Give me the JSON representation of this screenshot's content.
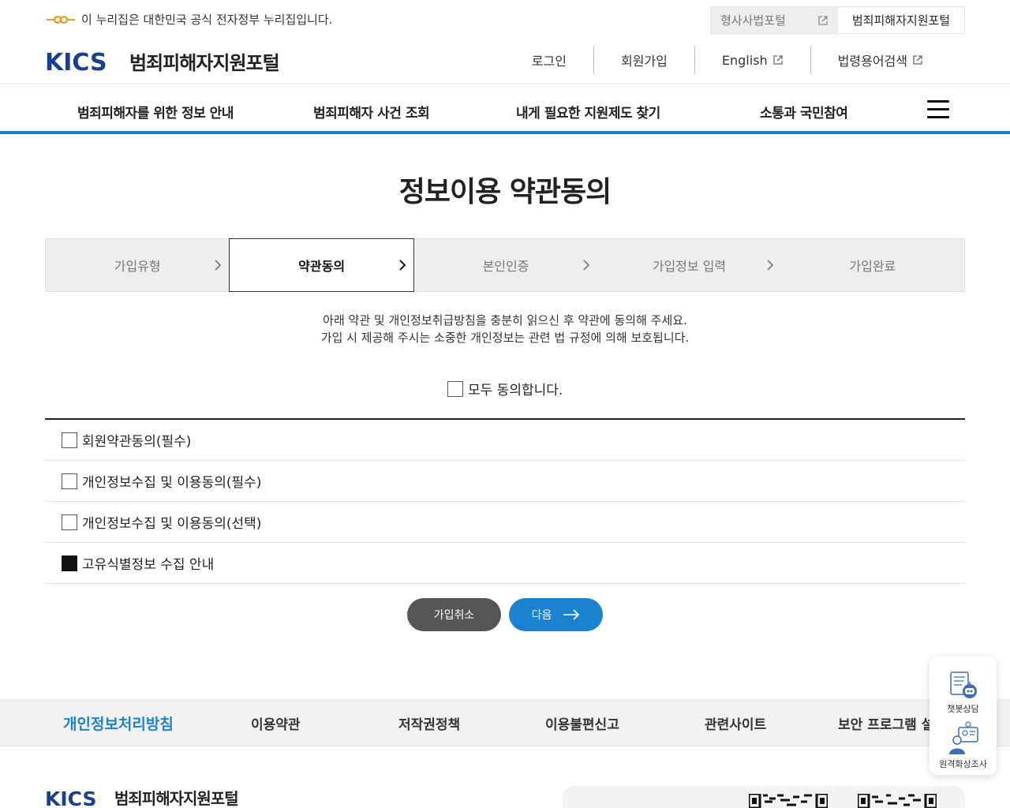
{
  "gov_banner": {
    "text": "이 누리집은 대한민국 공식 전자정부 누리집입니다.",
    "portal_switch": [
      "형사사법포털",
      "범죄피해자지원포털"
    ]
  },
  "header": {
    "logo_text": "KICS",
    "title": "범죄피해자지원포털",
    "util_links": [
      "로그인",
      "회원가입",
      "English",
      "법령용어검색"
    ]
  },
  "gnb": {
    "items": [
      "범죄피해자를 위한 정보 안내",
      "범죄피해자 사건 조회",
      "내게 필요한 지원제도 찾기",
      "소통과 국민참여"
    ],
    "menu_icon": "hamburger-icon"
  },
  "page_title": "정보이용 약관동의",
  "steps": [
    {
      "label": "가입유형",
      "active": false
    },
    {
      "label": "약관동의",
      "active": true
    },
    {
      "label": "본인인증",
      "active": false
    },
    {
      "label": "가입정보 입력",
      "active": false
    },
    {
      "label": "가입완료",
      "active": false
    }
  ],
  "intro": {
    "line1": "아래 약관 및 개인정보취급방침을 충분히 읽으신 후 약관에 동의해 주세요.",
    "line2": "가입 시 제공해 주시는 소중한 개인정보는 관련 법 규정에 의해 보호됩니다."
  },
  "agree_all": "모두 동의합니다.",
  "terms": [
    {
      "label": "회원약관동의(필수)",
      "checked": false
    },
    {
      "label": "개인정보수집 및 이용동의(필수)",
      "checked": false
    },
    {
      "label": "개인정보수집 및 이용동의(선택)",
      "checked": false
    },
    {
      "label": "고유식별정보 수집 안내",
      "checked": true
    }
  ],
  "buttons": {
    "cancel": "가입취소",
    "next": "다음"
  },
  "footer_nav": [
    "개인정보처리방침",
    "이용약관",
    "저작권정책",
    "이용불편신고",
    "관련사이트",
    "보안 프로그램 설치"
  ],
  "float": {
    "chatbot": "챗봇상담",
    "video": "원격화상조사"
  },
  "footer": {
    "logo_text": "KICS",
    "title": "범죄피해자지원포털"
  },
  "colors": {
    "accent": "#1b82d1",
    "cancel": "#555555"
  }
}
